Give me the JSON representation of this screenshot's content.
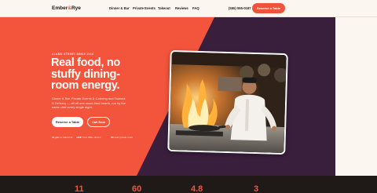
{
  "nav": {
    "logo_part1": "Ember",
    "logo_amp": "&",
    "logo_part2": "Rye",
    "links": [
      "Dinner & Bar",
      "Private Events",
      "Takeout",
      "Reviews",
      "FAQ"
    ],
    "phone": "(555) 555-0187",
    "cta_label": "Reserve a Table"
  },
  "hero": {
    "eyebrow": "ALAMO STREET SINCE 2016",
    "headline": "Real food, no stuffy dining-room energy.",
    "subtext": "Dinner & Bar, Private Events & Catering and Takeout & Delivery — all off one wood-fired hearth, run by the same chef every single night.",
    "primary_button": "Reserve a Table",
    "secondary_button": "Call Now",
    "stats": [
      {
        "strong": "11 yrs",
        "text": "on Alamo St."
      },
      {
        "strong": "4.8★",
        "text": "from 860+ diners"
      },
      {
        "strong": "60",
        "text": "seat private room"
      }
    ],
    "photo_alt": "Chef flambéing a pan in the kitchen"
  },
  "band": {
    "numbers": [
      "11",
      "60",
      "4.8",
      "3"
    ]
  },
  "colors": {
    "accent": "#f2543c",
    "plum": "#3a1f3d",
    "cream": "#fbf6ef",
    "dark": "#1f1a17"
  }
}
